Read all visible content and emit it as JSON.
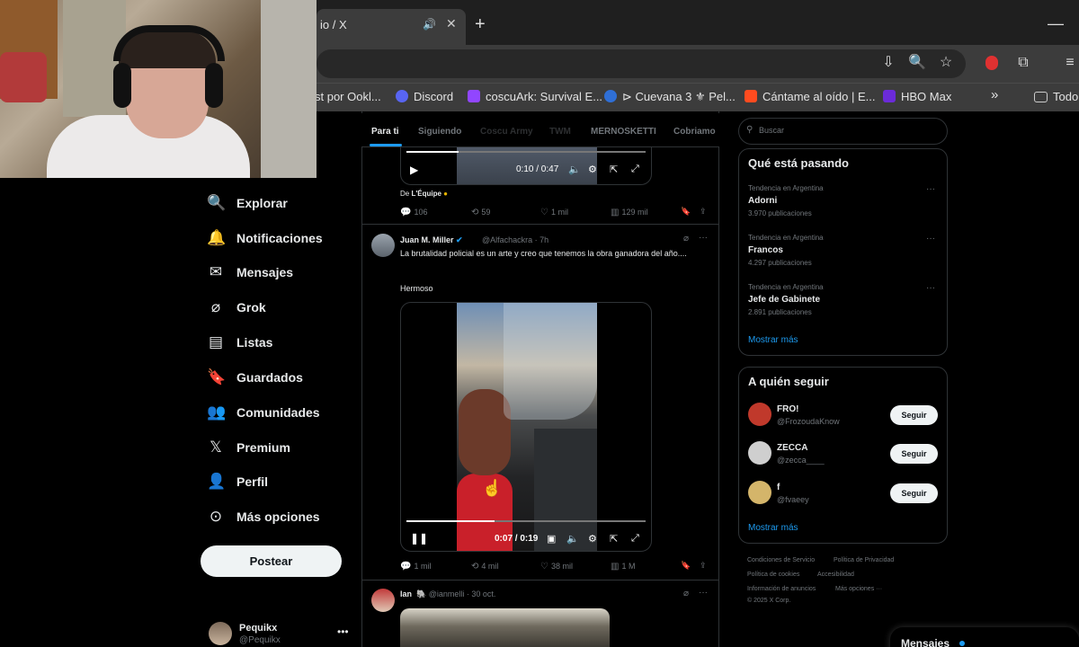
{
  "browser": {
    "tab_title": "io / X",
    "tab_speaker_icon": "speaker-icon",
    "tab_close": "✕",
    "new_tab": "+",
    "window_minimize": "—",
    "bookmarks": [
      {
        "label": "st por Ookl...",
        "color": ""
      },
      {
        "label": "Discord",
        "color": "#5865f2"
      },
      {
        "label": "coscuArk: Survival E...",
        "color": "#9146ff"
      },
      {
        "label": "⊳ Cuevana 3 ⚜ Pel...",
        "color": "#2f6fd6"
      },
      {
        "label": "Cántame al oído | E...",
        "color": "#ff4b1f"
      },
      {
        "label": "HBO Max",
        "color": "#6b2bd9"
      },
      {
        "label": "Todo",
        "color": ""
      }
    ],
    "overflow": "»"
  },
  "nav": {
    "items": [
      {
        "label": "Explorar",
        "icon": "🔍"
      },
      {
        "label": "Notificaciones",
        "icon": "🔔"
      },
      {
        "label": "Mensajes",
        "icon": "✉"
      },
      {
        "label": "Grok",
        "icon": "⌀"
      },
      {
        "label": "Listas",
        "icon": "▤"
      },
      {
        "label": "Guardados",
        "icon": "🔖"
      },
      {
        "label": "Comunidades",
        "icon": "👥"
      },
      {
        "label": "Premium",
        "icon": "𝕏"
      },
      {
        "label": "Perfil",
        "icon": "👤"
      },
      {
        "label": "Más opciones",
        "icon": "⊙"
      }
    ],
    "post_button": "Postear",
    "account_name": "Pequikx",
    "account_handle": "@Pequikx",
    "account_more": "•••"
  },
  "feed": {
    "tabs": [
      "Para ti",
      "Siguiendo",
      "Coscu Army",
      "TWM",
      "MERNOSKETTI",
      "Cobriamo"
    ],
    "post1": {
      "video_time": "0:10 / 0:47",
      "source_prefix": "De",
      "source_name": "L'Équipe",
      "replies": "106",
      "reposts": "59",
      "likes": "1 mil",
      "views": "129 mil"
    },
    "post2": {
      "author": "Juan M. Miller",
      "handle_time": "@Alfachackra · 7h",
      "text": "La brutalidad policial es un arte y creo que tenemos la obra ganadora del año....",
      "text2": "Hermoso",
      "video_time": "0:07 / 0:19",
      "video_progress": 0.37,
      "replies": "1 mil",
      "reposts": "4 mil",
      "likes": "38 mil",
      "views": "1 M"
    },
    "post3": {
      "author": "Ian",
      "handle_time": "@ianmelli · 30 oct."
    }
  },
  "sidebar": {
    "search_placeholder": "Buscar",
    "trends_title": "Qué está pasando",
    "trends": [
      {
        "context": "Tendencia en Argentina",
        "name": "Adorni",
        "count": "3.970 publicaciones"
      },
      {
        "context": "Tendencia en Argentina",
        "name": "Francos",
        "count": "4.297 publicaciones"
      },
      {
        "context": "Tendencia en Argentina",
        "name": "Jefe de Gabinete",
        "count": "2.891 publicaciones"
      }
    ],
    "trends_more": "Mostrar más",
    "follow_title": "A quién seguir",
    "follow": [
      {
        "name": "FRO!",
        "handle": "@FrozoudaKnow",
        "button": "Seguir",
        "color": "#c0392b"
      },
      {
        "name": "ZECCA",
        "handle": "@zecca____",
        "button": "Seguir",
        "color": "#cfcfcf"
      },
      {
        "name": "f",
        "handle": "@fvaeey",
        "button": "Seguir",
        "color": "#d4b56a"
      }
    ],
    "follow_more": "Mostrar más",
    "footer": [
      "Condiciones de Servicio",
      "Política de Privacidad",
      "Política de cookies",
      "Accesibilidad",
      "Información de anuncios",
      "Más opciones ···",
      "© 2025 X Corp."
    ],
    "messages": "Mensajes"
  }
}
